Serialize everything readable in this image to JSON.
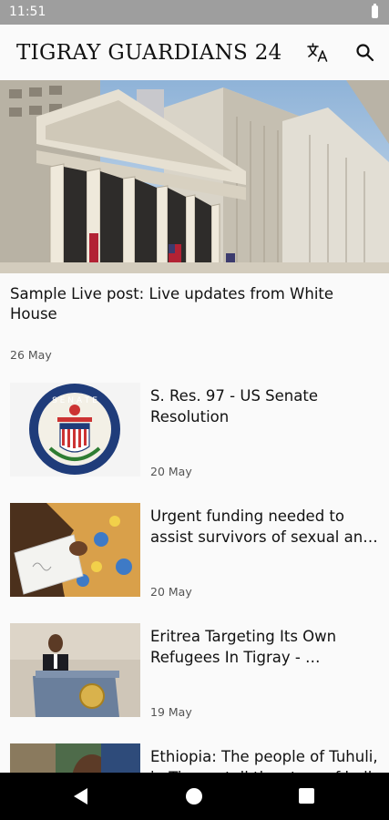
{
  "status_bar": {
    "time": "11:51"
  },
  "app_bar": {
    "title": "TIGRAY GUARDIANS 24",
    "translate_icon": "translate-icon",
    "search_icon": "search-icon"
  },
  "featured": {
    "title": "Sample Live post: Live updates from White House",
    "date": "26 May"
  },
  "articles": [
    {
      "title": "S. Res. 97 - US Senate Resolution",
      "date": "20 May"
    },
    {
      "title": "Urgent funding needed to assist survivors of sexual and gender-based violence in Tigray",
      "date": "20 May"
    },
    {
      "title": "Eritrea Targeting Its Own Refugees In Tigray - …",
      "date": "19 May"
    },
    {
      "title": "Ethiopia: The people of Tuhuli, in Tigray, tell the story of hell",
      "date": ""
    }
  ],
  "nav_bar": {
    "back_icon": "back-icon",
    "home_icon": "home-icon",
    "recents_icon": "recents-icon"
  }
}
